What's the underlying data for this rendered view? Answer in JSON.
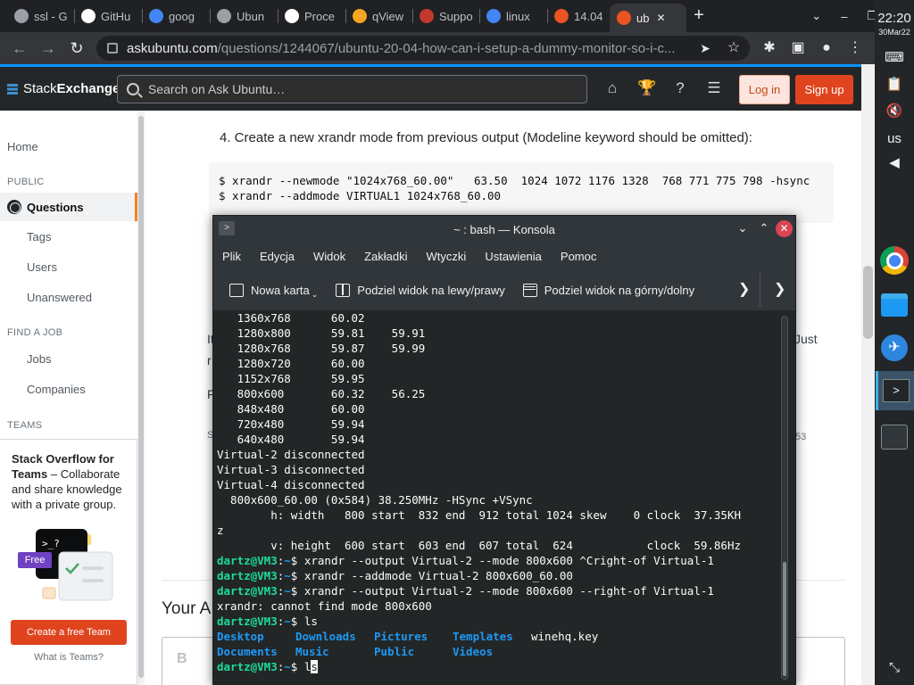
{
  "browser": {
    "tabs": [
      {
        "label": "ssl - G",
        "fav": "ssl-favicon",
        "color": "#9aa0a6"
      },
      {
        "label": "GitHu",
        "fav": "github-icon",
        "color": "#ffffff"
      },
      {
        "label": "goog",
        "fav": "google-icon",
        "color": "#4285f4"
      },
      {
        "label": "Ubun",
        "fav": "globe-icon",
        "color": "#9aa0a6"
      },
      {
        "label": "Proce",
        "fav": "a-icon",
        "color": "#ffffff"
      },
      {
        "label": "qView",
        "fav": "qview-icon",
        "color": "#f5a623"
      },
      {
        "label": "Suppo",
        "fav": "support-icon",
        "color": "#c0392b"
      },
      {
        "label": "linux",
        "fav": "google-icon",
        "color": "#4285f4"
      },
      {
        "label": "14.04",
        "fav": "askubuntu-icon",
        "color": "#e95420"
      },
      {
        "label": "ub",
        "fav": "askubuntu-icon",
        "color": "#e95420"
      }
    ],
    "url_host": "askubuntu.com",
    "url_path": "/questions/1244067/ubuntu-20-04-how-can-i-setup-a-dummy-monitor-so-i-c..."
  },
  "se": {
    "brand_a": "Stack",
    "brand_b": "Exchange",
    "search_placeholder": "Search on Ask Ubuntu…",
    "login": "Log in",
    "signup": "Sign up"
  },
  "nav": {
    "home": "Home",
    "public_head": "PUBLIC",
    "questions": "Questions",
    "tags": "Tags",
    "users": "Users",
    "unanswered": "Unanswered",
    "job_head": "FIND A JOB",
    "jobs": "Jobs",
    "companies": "Companies",
    "teams_head": "TEAMS",
    "teams_title": "Stack Overflow for Teams",
    "teams_desc": " – Collaborate and share knowledge with a private group.",
    "free_badge": "Free",
    "teams_cta": "Create a free Team",
    "teams_what": "What is Teams?"
  },
  "content": {
    "step": "4. Create a new xrandr mode from previous output (Modeline keyword should be omitted):",
    "code_line1": "$ xrandr --newmode \"1024x768_60.00\"   63.50  1024 1072 1176 1328  768 771 775 798 -hsync",
    "code_line2": "$ xrandr --addmode VIRTUAL1 1024x768_60.00",
    "peek_it": "It",
    "peek_r": "r",
    "peek_just": "Just",
    "peek_f": "F",
    "peek_s": "S",
    "peek_53": "53",
    "your_answer": "Your A",
    "bold_btn": "B"
  },
  "konsole": {
    "title": "~ : bash — Konsola",
    "menu": [
      "Plik",
      "Edycja",
      "Widok",
      "Zakładki",
      "Wtyczki",
      "Ustawienia",
      "Pomoc"
    ],
    "tool_new_tab": "Nowa karta",
    "tool_split_lr": "Podziel widok na lewy/prawy",
    "tool_split_tb": "Podziel widok na górny/dolny",
    "lines": [
      {
        "t": "   1360x768      60.02"
      },
      {
        "t": "   1280x800      59.81    59.91"
      },
      {
        "t": "   1280x768      59.87    59.99"
      },
      {
        "t": "   1280x720      60.00"
      },
      {
        "t": "   1152x768      59.95"
      },
      {
        "t": "   800x600       60.32    56.25"
      },
      {
        "t": "   848x480       60.00"
      },
      {
        "t": "   720x480       59.94"
      },
      {
        "t": "   640x480       59.94"
      },
      {
        "t": "Virtual-2 disconnected"
      },
      {
        "t": "Virtual-3 disconnected"
      },
      {
        "t": "Virtual-4 disconnected"
      },
      {
        "t": "  800x600_60.00 (0x584) 38.250MHz -HSync +VSync"
      },
      {
        "t": "        h: width   800 start  832 end  912 total 1024 skew    0 clock  37.35KH"
      },
      {
        "t": "z"
      },
      {
        "t": "        v: height  600 start  603 end  607 total  624           clock  59.86Hz"
      },
      {
        "p": "dartz@VM3",
        "t": "$ xrandr --output Virtual-2 --mode 800x600 ^Cright-of Virtual-1"
      },
      {
        "p": "dartz@VM3",
        "t": "$ xrandr --addmode Virtual-2 800x600_60.00"
      },
      {
        "p": "dartz@VM3",
        "t": "$ xrandr --output Virtual-2 --mode 800x600 --right-of Virtual-1"
      },
      {
        "t": "xrandr: cannot find mode 800x600"
      },
      {
        "p": "dartz@VM3",
        "t": "$ ls"
      },
      {
        "dirs": [
          "Desktop",
          "Downloads",
          "Pictures",
          "Templates"
        ],
        "extra": "winehq.key"
      },
      {
        "dirs": [
          "Documents",
          "Music",
          "Public",
          "Videos"
        ]
      },
      {
        "p": "dartz@VM3",
        "t": "$ l",
        "cursor": "s"
      }
    ]
  },
  "os": {
    "time": "22:20",
    "date": "30Mar22",
    "lang": "us"
  },
  "colors": {
    "accent_orange": "#f48024",
    "signup_red": "#e0441f",
    "prompt_green": "#1cdc9a",
    "dir_blue": "#1d99f3"
  }
}
